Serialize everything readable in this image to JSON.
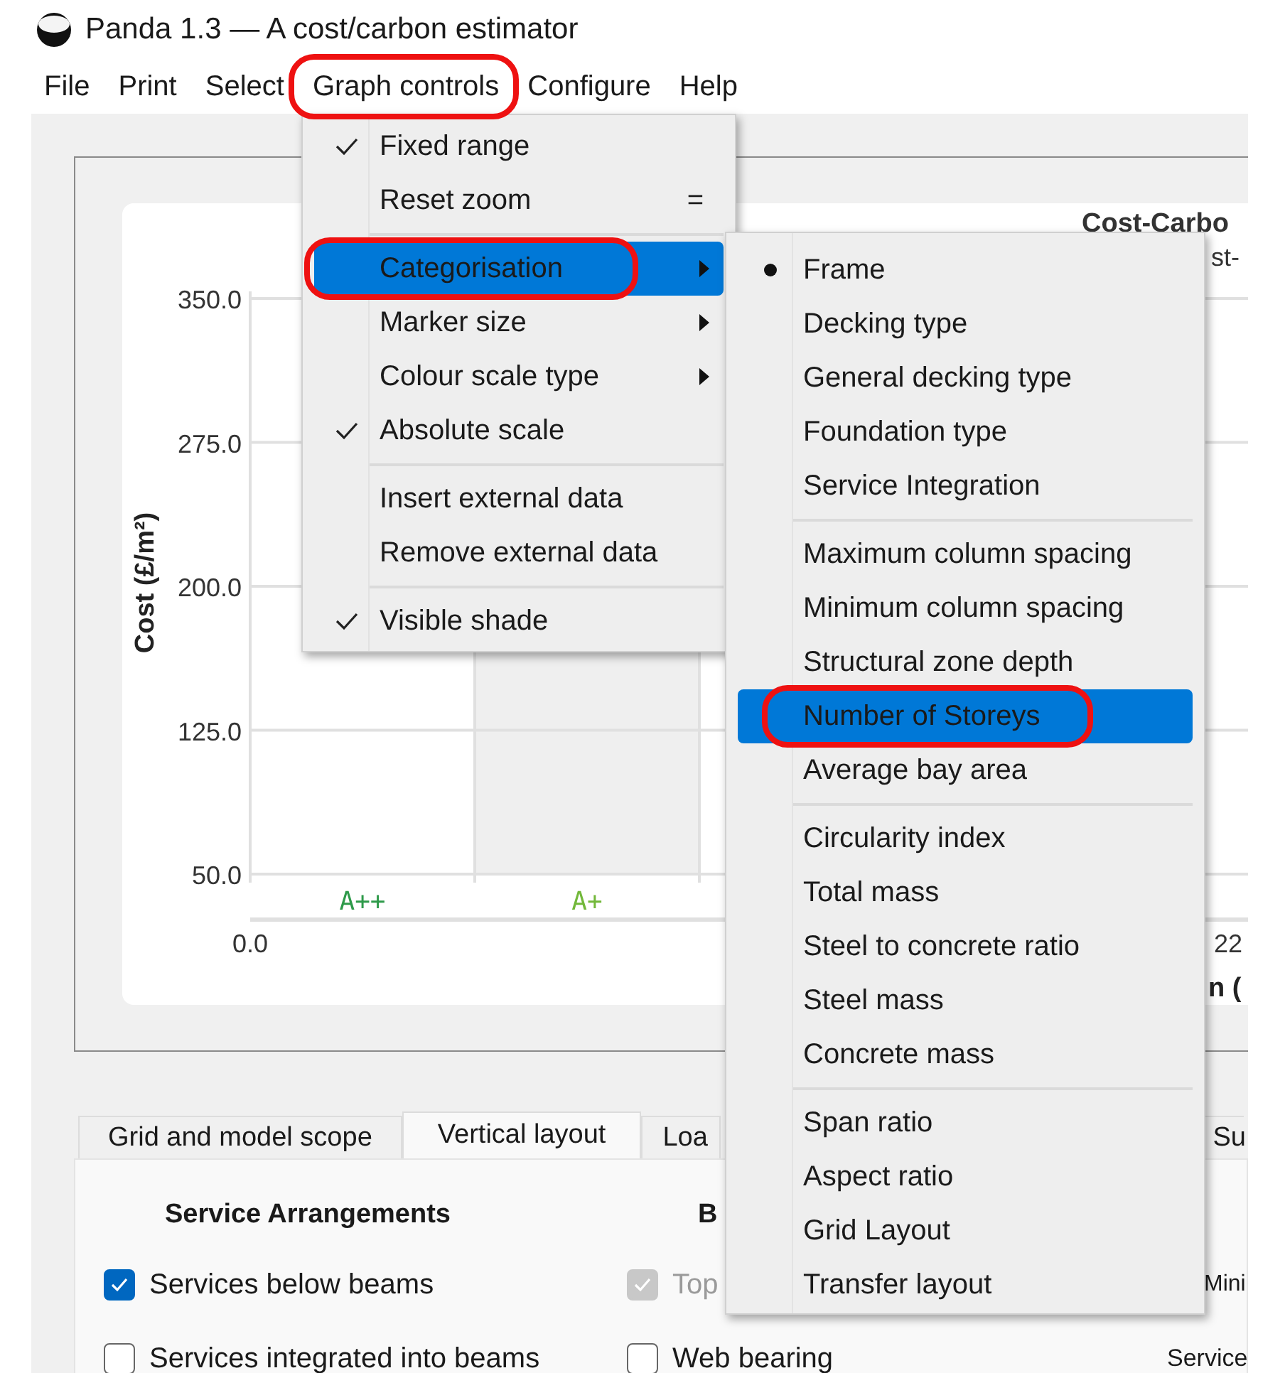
{
  "window": {
    "title": "Panda 1.3 — A cost/carbon estimator"
  },
  "menubar": [
    {
      "label": "File",
      "annotated": false
    },
    {
      "label": "Print",
      "annotated": false
    },
    {
      "label": "Select",
      "annotated": false
    },
    {
      "label": "Graph controls",
      "annotated": true
    },
    {
      "label": "Configure",
      "annotated": false
    },
    {
      "label": "Help",
      "annotated": false
    }
  ],
  "menu": {
    "items": [
      {
        "kind": "item",
        "label": "Fixed range",
        "checked": true,
        "highlighted": false,
        "submenu": false,
        "annotated": false
      },
      {
        "kind": "item",
        "label": "Reset zoom",
        "shortcut": "=",
        "checked": false,
        "highlighted": false,
        "submenu": false,
        "annotated": false
      },
      {
        "kind": "separator"
      },
      {
        "kind": "item",
        "label": "Categorisation",
        "checked": false,
        "highlighted": true,
        "submenu": true,
        "annotated": true
      },
      {
        "kind": "item",
        "label": "Marker size",
        "checked": false,
        "highlighted": false,
        "submenu": true,
        "annotated": false
      },
      {
        "kind": "item",
        "label": "Colour scale type",
        "checked": false,
        "highlighted": false,
        "submenu": true,
        "annotated": false
      },
      {
        "kind": "item",
        "label": "Absolute scale",
        "checked": true,
        "highlighted": false,
        "submenu": false,
        "annotated": false
      },
      {
        "kind": "separator"
      },
      {
        "kind": "item",
        "label": "Insert external data",
        "checked": false,
        "highlighted": false,
        "submenu": false,
        "annotated": false
      },
      {
        "kind": "item",
        "label": "Remove external data",
        "checked": false,
        "highlighted": false,
        "submenu": false,
        "annotated": false
      },
      {
        "kind": "separator"
      },
      {
        "kind": "item",
        "label": "Visible shade",
        "checked": true,
        "highlighted": false,
        "submenu": false,
        "annotated": false
      }
    ]
  },
  "submenu": {
    "items": [
      {
        "kind": "item",
        "label": "Frame",
        "selected": true,
        "highlighted": false,
        "annotated": false
      },
      {
        "kind": "item",
        "label": "Decking type",
        "selected": false,
        "highlighted": false,
        "annotated": false
      },
      {
        "kind": "item",
        "label": "General decking type",
        "selected": false,
        "highlighted": false,
        "annotated": false
      },
      {
        "kind": "item",
        "label": "Foundation type",
        "selected": false,
        "highlighted": false,
        "annotated": false
      },
      {
        "kind": "item",
        "label": "Service Integration",
        "selected": false,
        "highlighted": false,
        "annotated": false
      },
      {
        "kind": "separator"
      },
      {
        "kind": "item",
        "label": "Maximum column spacing",
        "selected": false,
        "highlighted": false,
        "annotated": false
      },
      {
        "kind": "item",
        "label": "Minimum column spacing",
        "selected": false,
        "highlighted": false,
        "annotated": false
      },
      {
        "kind": "item",
        "label": "Structural zone depth",
        "selected": false,
        "highlighted": false,
        "annotated": false
      },
      {
        "kind": "item",
        "label": "Number of Storeys",
        "selected": false,
        "highlighted": true,
        "annotated": true
      },
      {
        "kind": "item",
        "label": "Average bay area",
        "selected": false,
        "highlighted": false,
        "annotated": false
      },
      {
        "kind": "separator"
      },
      {
        "kind": "item",
        "label": "Circularity index",
        "selected": false,
        "highlighted": false,
        "annotated": false
      },
      {
        "kind": "item",
        "label": "Total mass",
        "selected": false,
        "highlighted": false,
        "annotated": false
      },
      {
        "kind": "item",
        "label": "Steel to concrete ratio",
        "selected": false,
        "highlighted": false,
        "annotated": false
      },
      {
        "kind": "item",
        "label": "Steel mass",
        "selected": false,
        "highlighted": false,
        "annotated": false
      },
      {
        "kind": "item",
        "label": "Concrete mass",
        "selected": false,
        "highlighted": false,
        "annotated": false
      },
      {
        "kind": "separator"
      },
      {
        "kind": "item",
        "label": "Span ratio",
        "selected": false,
        "highlighted": false,
        "annotated": false
      },
      {
        "kind": "item",
        "label": "Aspect ratio",
        "selected": false,
        "highlighted": false,
        "annotated": false
      },
      {
        "kind": "item",
        "label": "Grid Layout",
        "selected": false,
        "highlighted": false,
        "annotated": false
      },
      {
        "kind": "item",
        "label": "Transfer layout",
        "selected": false,
        "highlighted": false,
        "annotated": false
      }
    ]
  },
  "chart": {
    "title": "Cost-Carbo",
    "subtitle": "st-",
    "y_label": "Cost (£/m²)",
    "x_label": "n (",
    "y_ticks": [
      "350.0",
      "275.0",
      "200.0",
      "125.0",
      "50.0"
    ],
    "x_ticks": [
      "0.0",
      "22"
    ],
    "bands": [
      {
        "label": "A++",
        "color": "#2e9a4a",
        "shaded": false
      },
      {
        "label": "A+",
        "color": "#72b83a",
        "shaded": true
      }
    ]
  },
  "tabs": [
    {
      "label": "Grid and model scope",
      "selected": false
    },
    {
      "label": "Vertical layout",
      "selected": true
    },
    {
      "label": "Loa",
      "selected": false
    },
    {
      "label": "Su",
      "selected": false
    }
  ],
  "panel": {
    "headings": [
      "Service Arrangements",
      "B"
    ],
    "rows": [
      [
        {
          "kind": "checkbox",
          "label": "Services below beams",
          "checked": true,
          "disabled": false
        },
        {
          "kind": "checkbox",
          "label": "Top",
          "checked": true,
          "disabled": true
        },
        {
          "kind": "text",
          "label": "Mini"
        }
      ],
      [
        {
          "kind": "checkbox",
          "label": "Services integrated into beams",
          "checked": false,
          "disabled": false
        },
        {
          "kind": "checkbox",
          "label": "Web bearing",
          "checked": false,
          "disabled": false
        },
        {
          "kind": "text",
          "label": "Service"
        }
      ]
    ]
  }
}
